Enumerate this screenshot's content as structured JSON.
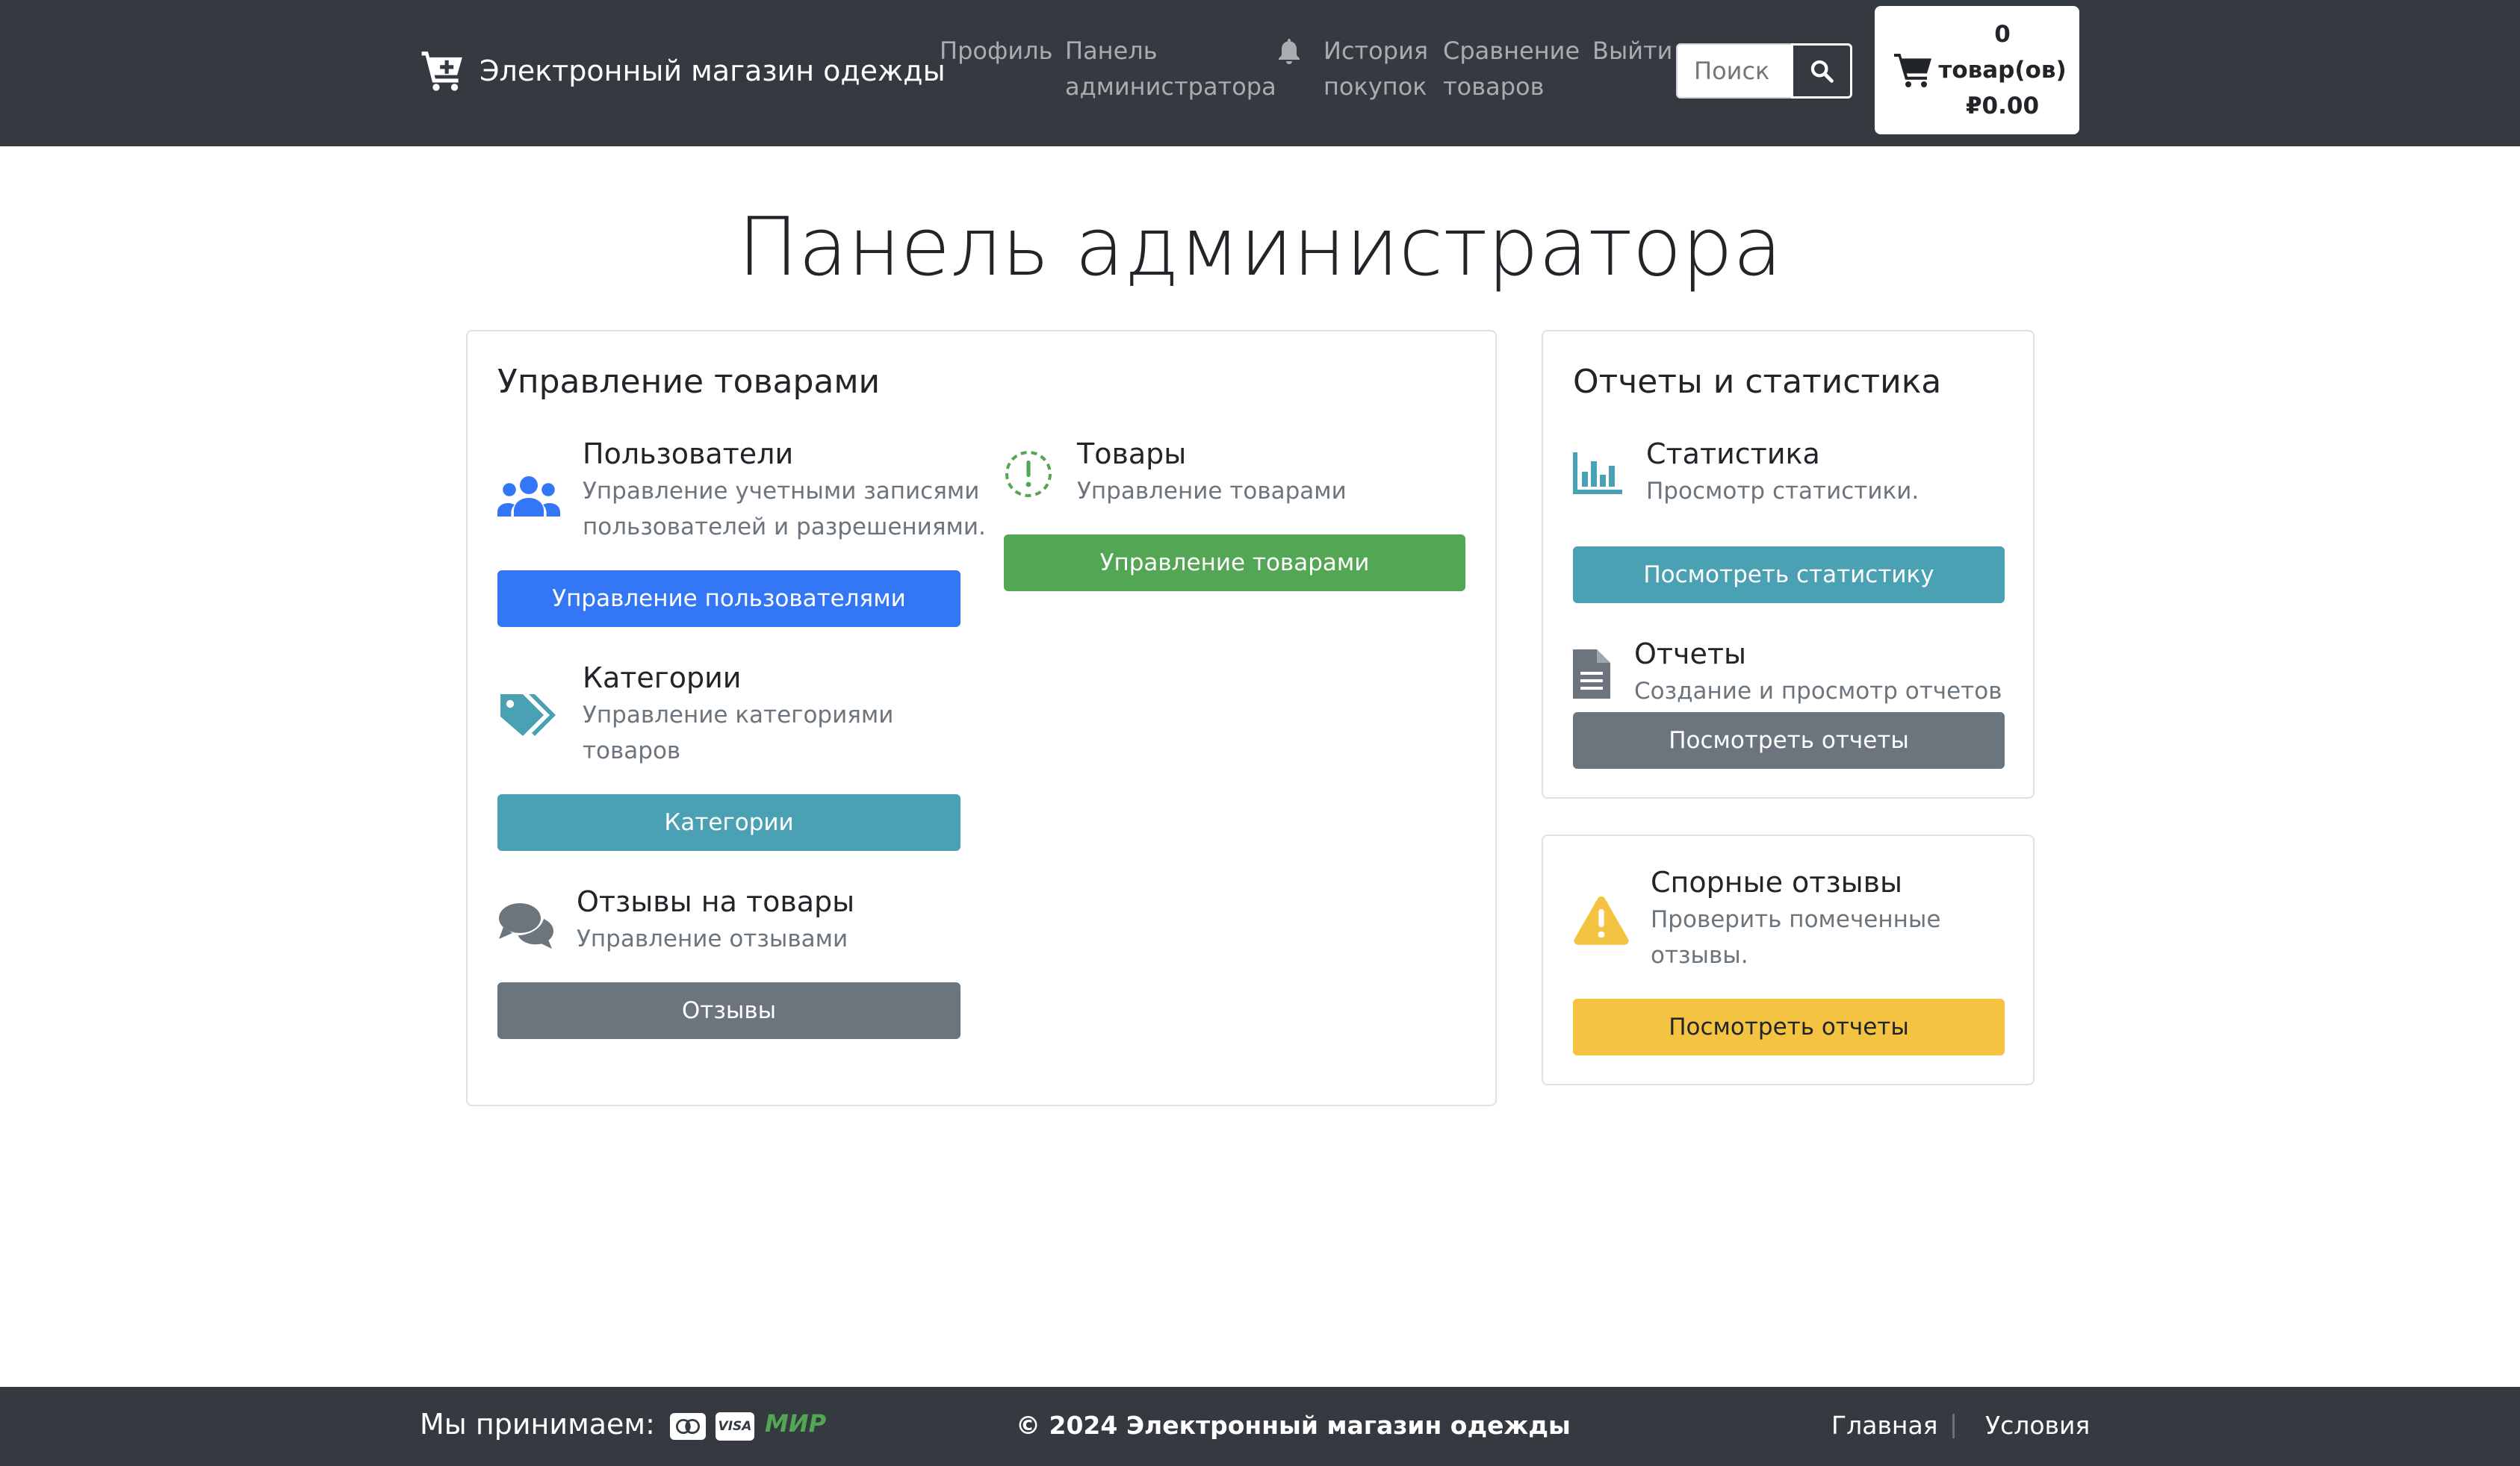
{
  "header": {
    "brand": "Электронный магазин одежды",
    "nav": {
      "profile": "Профиль",
      "admin_line1": "Панель",
      "admin_line2": "администратора",
      "history_line1": "История",
      "history_line2": "покупок",
      "compare_line1": "Сравнение",
      "compare_line2": "товаров",
      "logout": "Выйти"
    },
    "search": {
      "placeholder": "Поиск"
    },
    "cart": {
      "count": "0",
      "unit": "товар(ов)",
      "total": "₽0.00"
    }
  },
  "main": {
    "title": "Панель администратора",
    "products_card": {
      "title": "Управление товарами",
      "users": {
        "title": "Пользователи",
        "desc_line1": "Управление учетными записями",
        "desc_line2": "пользователей и разрешениями.",
        "button": "Управление пользователями"
      },
      "goods": {
        "title": "Товары",
        "desc": "Управление товарами",
        "button": "Управление товарами"
      },
      "categories": {
        "title": "Категории",
        "desc_line1": "Управление категориями",
        "desc_line2": "товаров",
        "button": "Категории"
      },
      "reviews": {
        "title": "Отзывы на товары",
        "desc": "Управление отзывами",
        "button": "Отзывы"
      }
    },
    "reports_card": {
      "title": "Отчеты и статистика",
      "stats": {
        "title": "Статистика",
        "desc": "Просмотр статистики.",
        "button": "Посмотреть статистику"
      },
      "reports": {
        "title": "Отчеты",
        "desc": "Создание и просмотр отчетов",
        "button": "Посмотреть отчеты"
      }
    },
    "disputed_card": {
      "title": "Спорные отзывы",
      "desc_line1": "Проверить помеченные",
      "desc_line2": "отзывы.",
      "button": "Посмотреть отчеты"
    }
  },
  "footer": {
    "accept": "Мы принимаем:",
    "payment_icons": [
      "mastercard-icon",
      "visa-icon",
      "mir-icon"
    ],
    "visa_text": "VISA",
    "mir_text": "МИР",
    "copyright": "© 2024 Электронный магазин одежды",
    "link_home": "Главная",
    "separator": "|",
    "link_terms": "Условия"
  },
  "colors": {
    "navbar": "#343a40",
    "primary": "#3377f6",
    "success": "#53a653",
    "info": "#4aa1b4",
    "secondary": "#6c757d",
    "warning": "#f5c342"
  }
}
